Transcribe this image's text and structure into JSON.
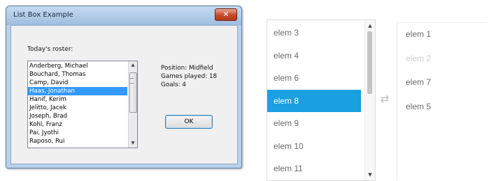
{
  "dialog": {
    "title": "List Box Example",
    "close_glyph": "✕",
    "roster_label": "Today's roster:",
    "roster": [
      "Anderberg, Michael",
      "Bouchard, Thomas",
      "Camp, David",
      "Haas, Jonathan",
      "Hanif, Kerim",
      "Jelitto, Jacek",
      "Joseph, Brad",
      "Kohl, Franz",
      "Pai, Jyothi",
      "Raposo, Rui"
    ],
    "selected_index": 3,
    "details": {
      "position": "Position: Midfield",
      "games": "Games played: 18",
      "goals": "Goals: 4"
    },
    "ok_label": "OK",
    "scroll_up": "▲",
    "scroll_down": "▼"
  },
  "list_widget": {
    "source_items": [
      "elem 3",
      "elem 4",
      "elem 6",
      "elem 8",
      "elem 9",
      "elem 10",
      "elem 11"
    ],
    "source_selected_index": 3,
    "move_glyph": "⇄",
    "target_items": [
      "elem 1",
      "elem 2",
      "elem 7",
      "elem 5"
    ],
    "target_disabled_index": 1,
    "scroll_up": "▲",
    "scroll_down": "▼",
    "accent_color": "#1a9fe0"
  }
}
